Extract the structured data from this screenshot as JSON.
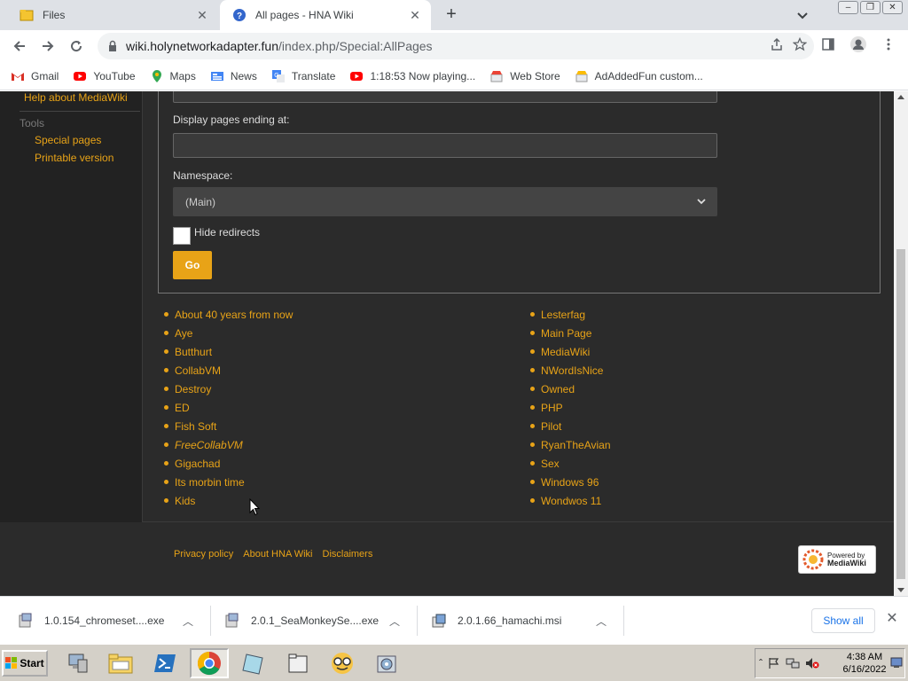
{
  "browser": {
    "tabs": [
      {
        "title": "Files",
        "active": false
      },
      {
        "title": "All pages - HNA Wiki",
        "active": true
      }
    ],
    "url": {
      "host": "wiki.holynetworkadapter.fun",
      "path": "/index.php/Special:AllPages"
    },
    "bookmarks": [
      "Gmail",
      "YouTube",
      "Maps",
      "News",
      "Translate",
      "1:18:53 Now playing...",
      "Web Store",
      "AdAddedFun custom..."
    ]
  },
  "sidebar": {
    "help": "Help about MediaWiki",
    "tools_heading": "Tools",
    "special_pages": "Special pages",
    "printable": "Printable version"
  },
  "form": {
    "ending_label": "Display pages ending at:",
    "ending_value": "",
    "namespace_label": "Namespace:",
    "namespace_value": "(Main)",
    "hide_redirects": "Hide redirects",
    "hide_redirects_checked": false,
    "go": "Go"
  },
  "pages": {
    "col1": [
      "About 40 years from now",
      "Aye",
      "Butthurt",
      "CollabVM",
      "Destroy",
      "ED",
      "Fish Soft",
      "FreeCollabVM",
      "Gigachad",
      "Its morbin time",
      "Kids"
    ],
    "col2": [
      "Lesterfag",
      "Main Page",
      "MediaWiki",
      "NWordIsNice",
      "Owned",
      "PHP",
      "Pilot",
      "RyanTheAvian",
      "Sex",
      "Windows 96",
      "Wondwos 11"
    ]
  },
  "footer": {
    "privacy": "Privacy policy",
    "about": "About HNA Wiki",
    "disclaimers": "Disclaimers",
    "powered_line1": "Powered by",
    "powered_line2": "MediaWiki"
  },
  "downloads": {
    "items": [
      "1.0.154_chromeset....exe",
      "2.0.1_SeaMonkeySe....exe",
      "2.0.1.66_hamachi.msi"
    ],
    "show_all": "Show all"
  },
  "taskbar": {
    "start": "Start",
    "time": "4:38 AM",
    "date": "6/16/2022"
  },
  "colors": {
    "link": "#e8a317",
    "page_bg": "#2b2b2b",
    "sidebar_bg": "#222222"
  }
}
